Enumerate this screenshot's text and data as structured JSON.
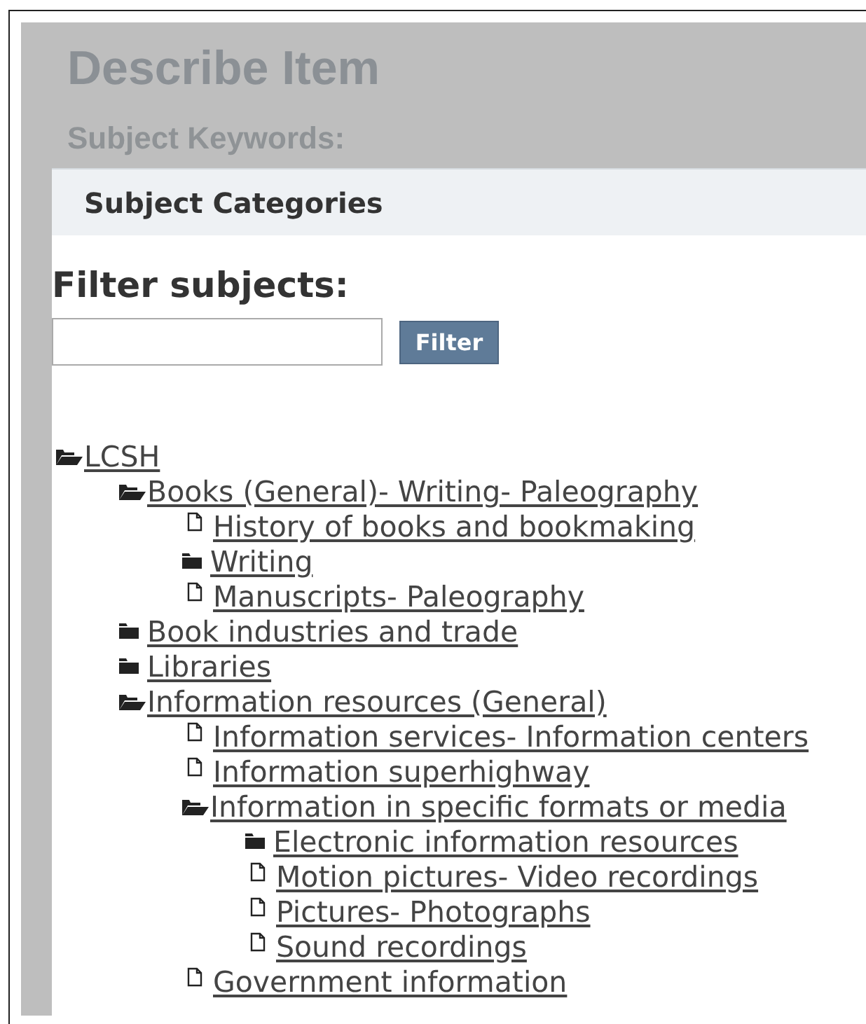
{
  "backdrop": {
    "title": "Describe Item",
    "field_label": "Subject Keywords:"
  },
  "dialog": {
    "title": "Subject Categories",
    "filter_label": "Filter subjects:",
    "filter_button": "Filter"
  },
  "tree": [
    {
      "label": "LCSH",
      "kind": "folder",
      "expanded": true,
      "children": [
        {
          "label": "Books (General)- Writing- Paleography",
          "kind": "folder",
          "expanded": true,
          "children": [
            {
              "label": "History of books and bookmaking",
              "kind": "page"
            },
            {
              "label": "Writing",
              "kind": "folder",
              "expanded": false
            },
            {
              "label": "Manuscripts- Paleography",
              "kind": "page"
            }
          ]
        },
        {
          "label": "Book industries and trade",
          "kind": "folder",
          "expanded": false
        },
        {
          "label": "Libraries",
          "kind": "folder",
          "expanded": false
        },
        {
          "label": "Information resources (General)",
          "kind": "folder",
          "expanded": true,
          "children": [
            {
              "label": "Information services- Information centers",
              "kind": "page"
            },
            {
              "label": "Information superhighway",
              "kind": "page"
            },
            {
              "label": "Information in specific formats or media",
              "kind": "folder",
              "expanded": true,
              "children": [
                {
                  "label": "Electronic information resources",
                  "kind": "folder",
                  "expanded": false
                },
                {
                  "label": "Motion pictures- Video recordings",
                  "kind": "page"
                },
                {
                  "label": "Pictures- Photographs",
                  "kind": "page"
                },
                {
                  "label": "Sound recordings",
                  "kind": "page"
                }
              ]
            },
            {
              "label": "Government information",
              "kind": "page"
            }
          ]
        }
      ]
    }
  ]
}
